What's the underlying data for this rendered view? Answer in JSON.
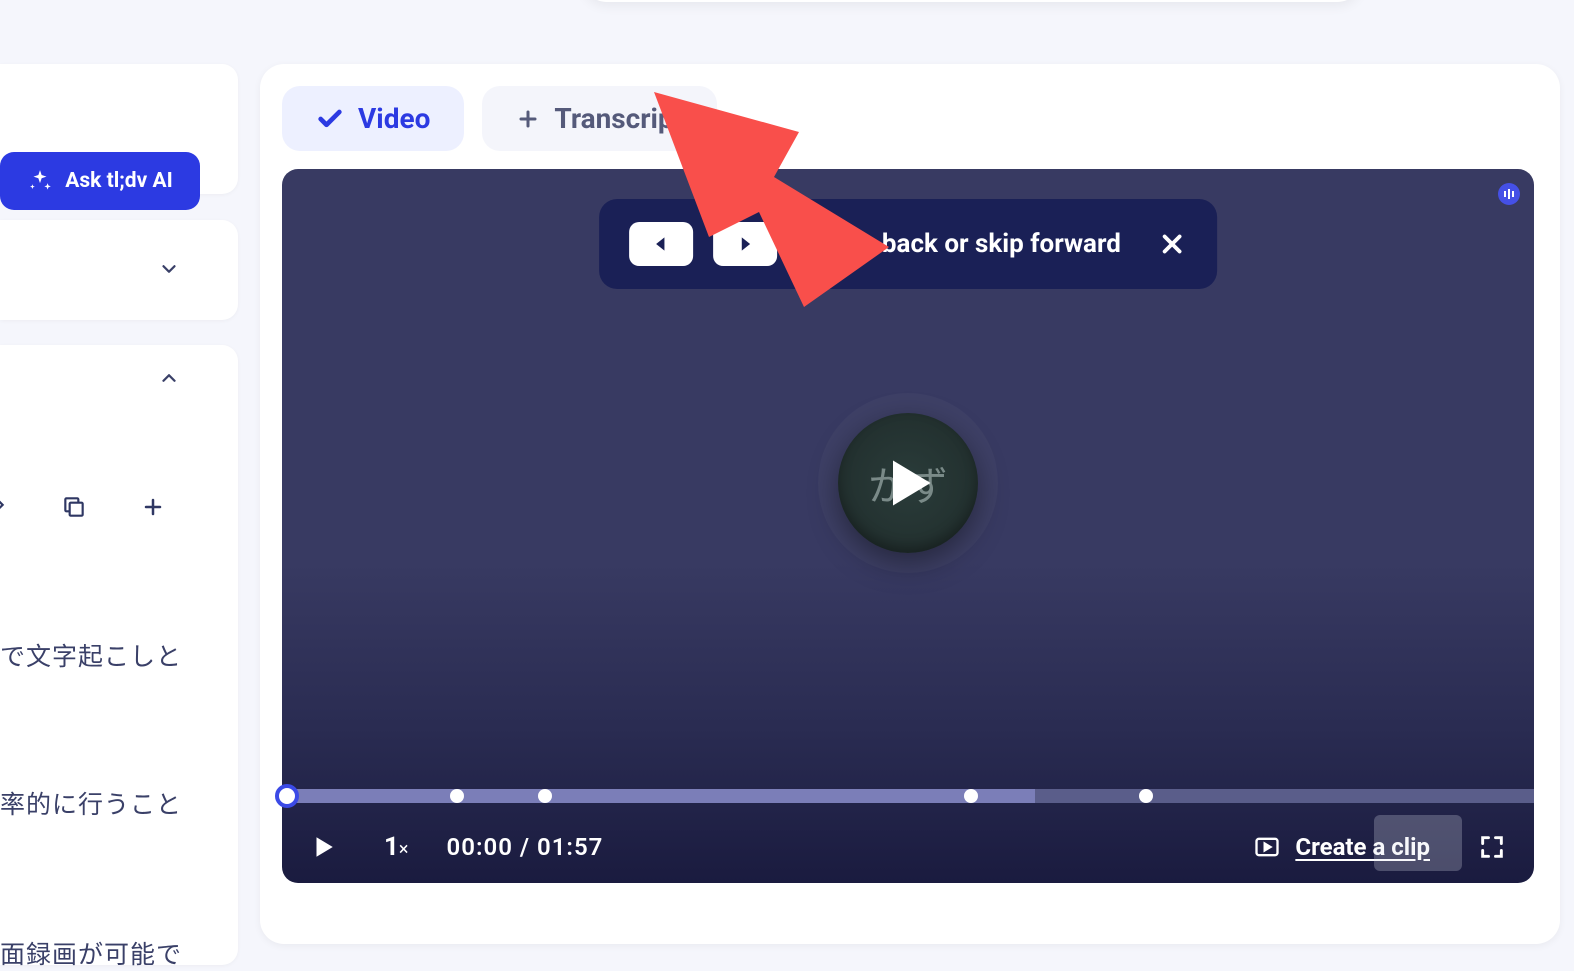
{
  "sidebar": {
    "ask_ai_label": "Ask tl;dv AI",
    "jp_lines": [
      "で文字起こしと",
      "率的に行うこと",
      "面録画が可能で"
    ]
  },
  "tabs": {
    "video_label": "Video",
    "transcript_label": "Transcript"
  },
  "player": {
    "skip_banner_text": "to skip back or skip forward",
    "avatar_text": "かず",
    "speed_label": "1",
    "time_current": "00:00",
    "time_separator": " / ",
    "time_total": "01:57",
    "create_clip_label": "Create a clip",
    "progress_markers_pct": [
      14,
      21,
      55,
      69
    ],
    "progress_played_pct": 60
  },
  "colors": {
    "accent": "#2c3ae2",
    "player_bg": "#383a62",
    "banner_bg": "#1a2056",
    "annotation": "#f94f4b"
  }
}
